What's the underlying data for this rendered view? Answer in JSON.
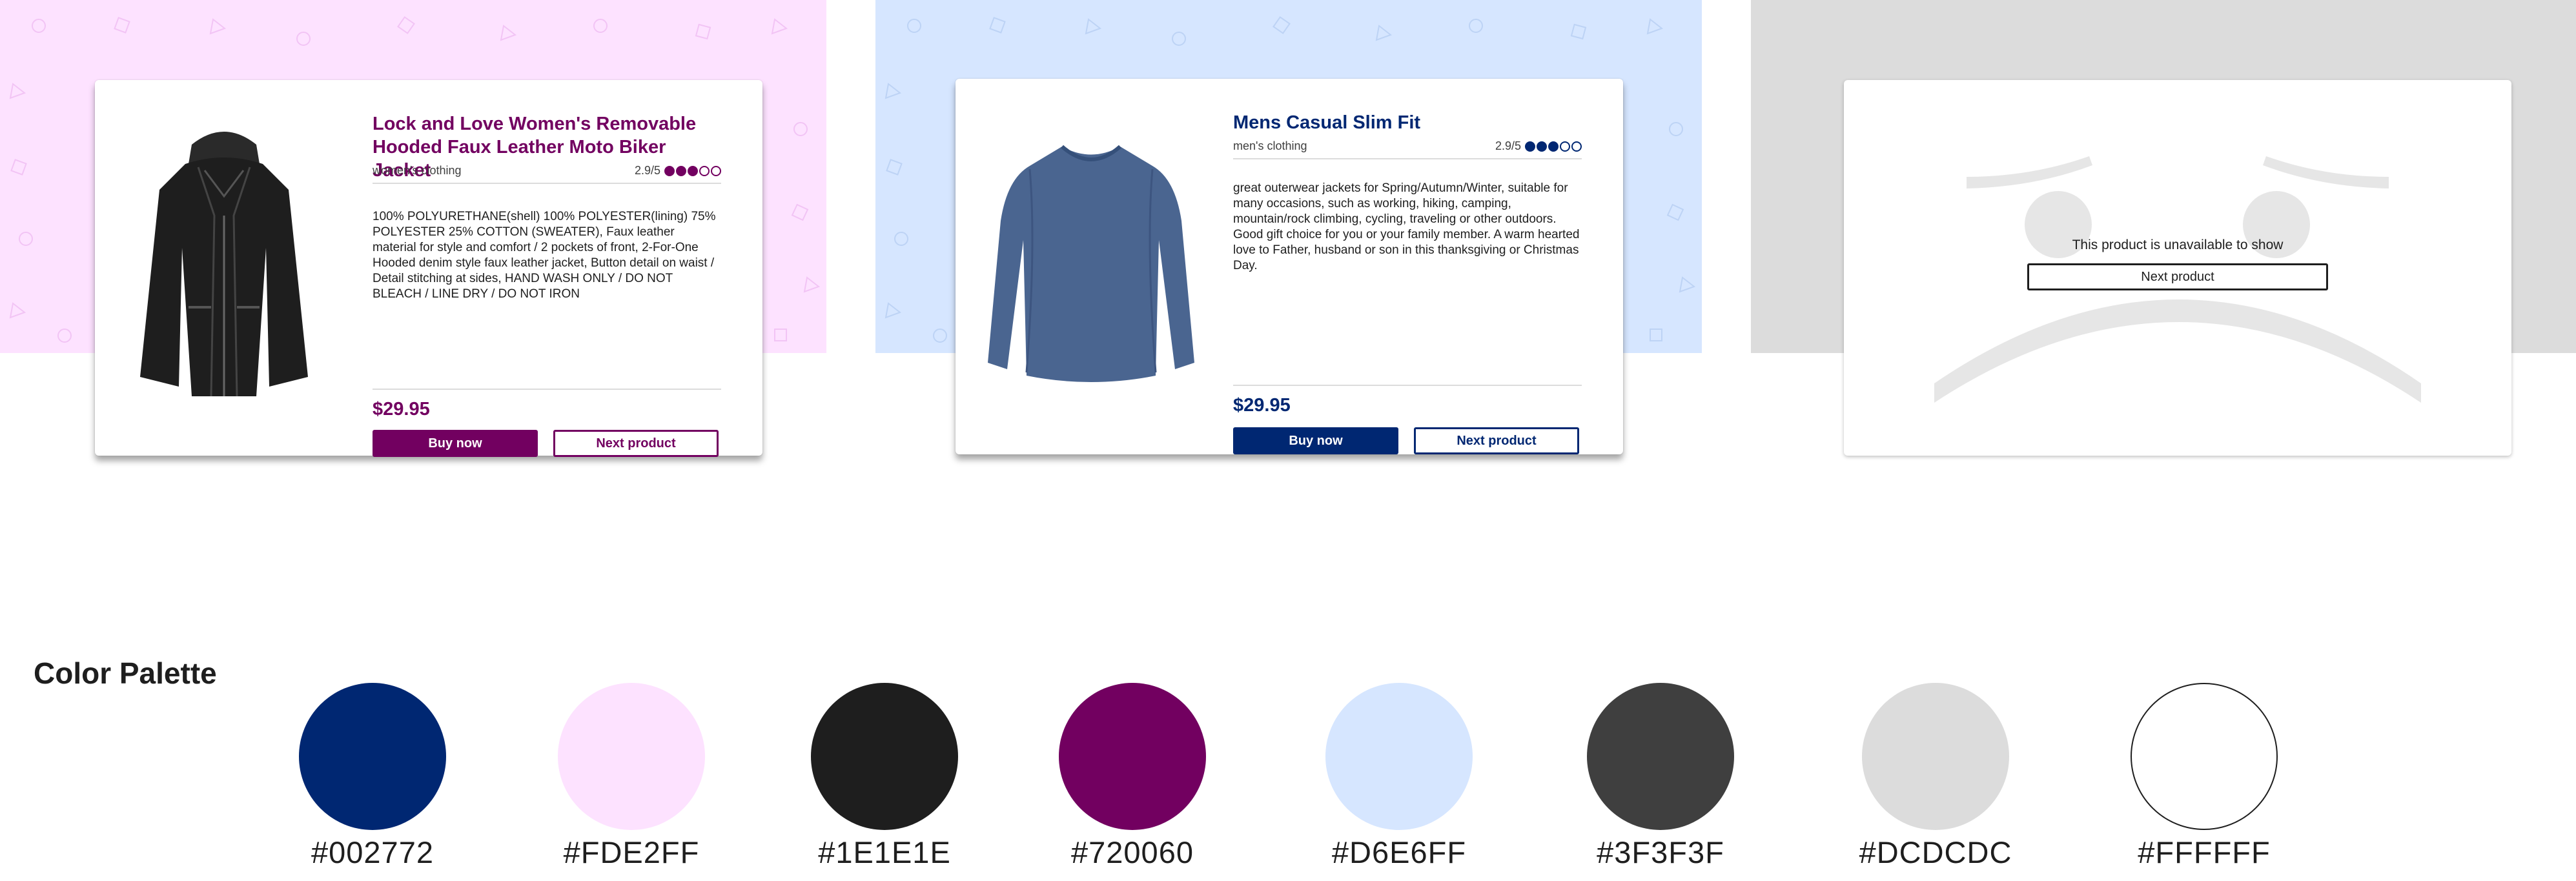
{
  "products": {
    "women": {
      "title": "Lock and Love Women's Removable Hooded Faux Leather Moto Biker Jacket",
      "category": "women's clothing",
      "rating_text": "2.9/5",
      "rating_value": 2.9,
      "rating_filled_dots": 3,
      "rating_total_dots": 5,
      "description": "100% POLYURETHANE(shell) 100% POLYESTER(lining) 75% POLYESTER 25% COTTON (SWEATER), Faux leather material for style and comfort / 2 pockets of front, 2-For-One Hooded denim style faux leather jacket, Button detail on waist / Detail stitching at sides, HAND WASH ONLY / DO NOT BLEACH / LINE DRY / DO NOT IRON",
      "price": "$29.95",
      "buy_label": "Buy now",
      "next_label": "Next product",
      "accent_color": "#720060",
      "background_color": "#FDE2FF",
      "image_icon": "black-leather-jacket-icon"
    },
    "men": {
      "title": "Mens Casual Slim Fit",
      "category": "men's clothing",
      "rating_text": "2.9/5",
      "rating_value": 2.9,
      "rating_filled_dots": 3,
      "rating_total_dots": 5,
      "description": "great outerwear jackets for Spring/Autumn/Winter, suitable for many occasions, such as working, hiking, camping, mountain/rock climbing, cycling, traveling or other outdoors. Good gift choice for you or your family member. A warm hearted love to Father, husband or son in this thanksgiving or Christmas Day.",
      "price": "$29.95",
      "buy_label": "Buy now",
      "next_label": "Next product",
      "accent_color": "#002772",
      "background_color": "#D6E6FF",
      "image_icon": "blue-long-sleeve-shirt-icon"
    },
    "unavailable": {
      "message": "This product is unavailable to show",
      "next_label": "Next product",
      "background_color": "#DCDCDC",
      "image_icon": "sad-face-icon"
    }
  },
  "palette": {
    "title": "Color Palette",
    "colors": [
      "#002772",
      "#FDE2FF",
      "#1E1E1E",
      "#720060",
      "#D6E6FF",
      "#3F3F3F",
      "#DCDCDC",
      "#FFFFFF"
    ]
  }
}
